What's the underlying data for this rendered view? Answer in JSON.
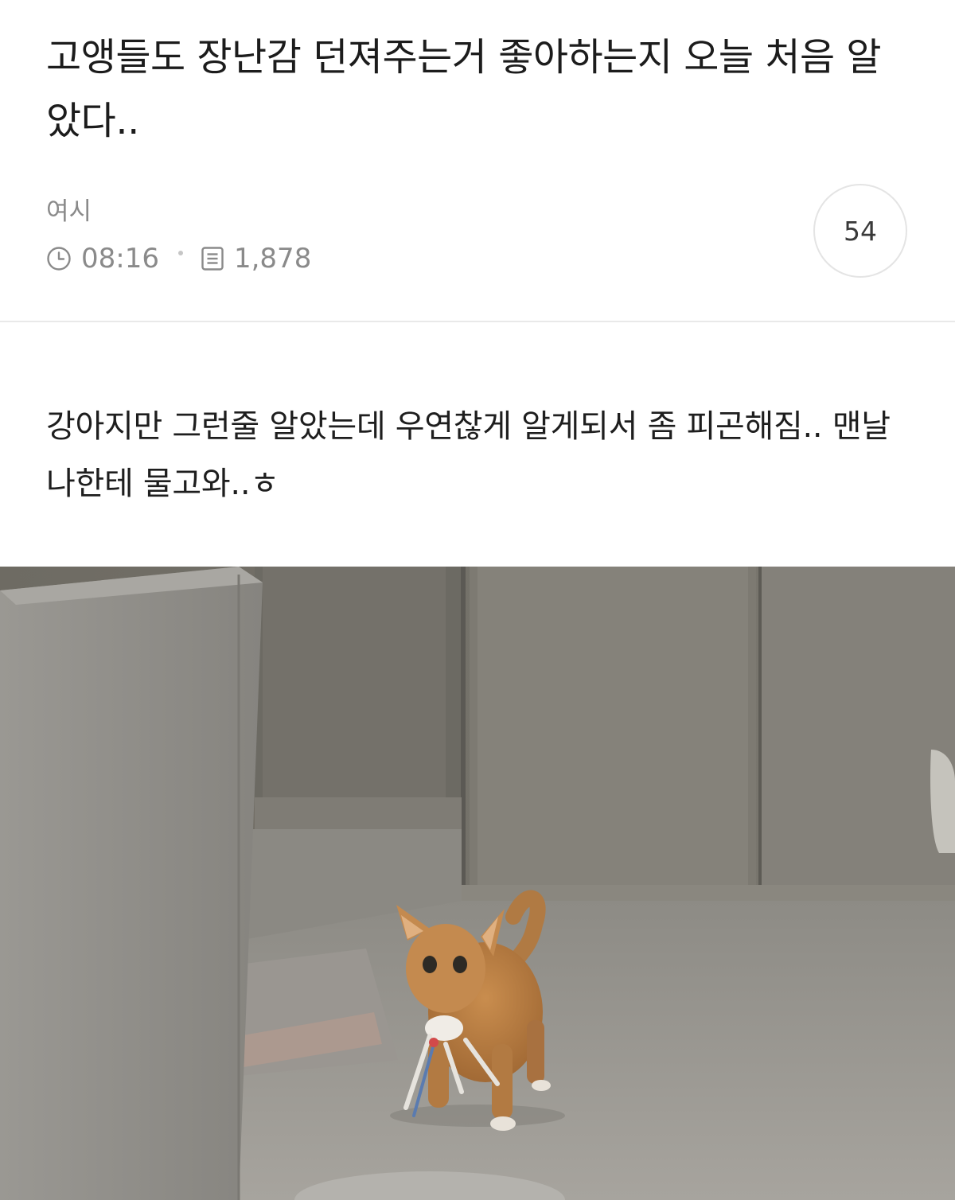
{
  "post": {
    "title": "고앵들도 장난감 던져주는거 좋아하는지 오늘 처음 알았다..",
    "author": "여시",
    "time": "08:16",
    "views": "1,878",
    "comment_count": "54",
    "body": "강아지만 그런줄 알았는데 우연찮게 알게되서 좀 피곤해짐.. 맨날 나한테 물고와..ㅎ"
  },
  "icons": {
    "time": "clock-icon",
    "views": "document-icon"
  },
  "colors": {
    "meta_text": "#8a8a8a",
    "divider": "#e9e9e9",
    "title_text": "#1c1c1c"
  }
}
